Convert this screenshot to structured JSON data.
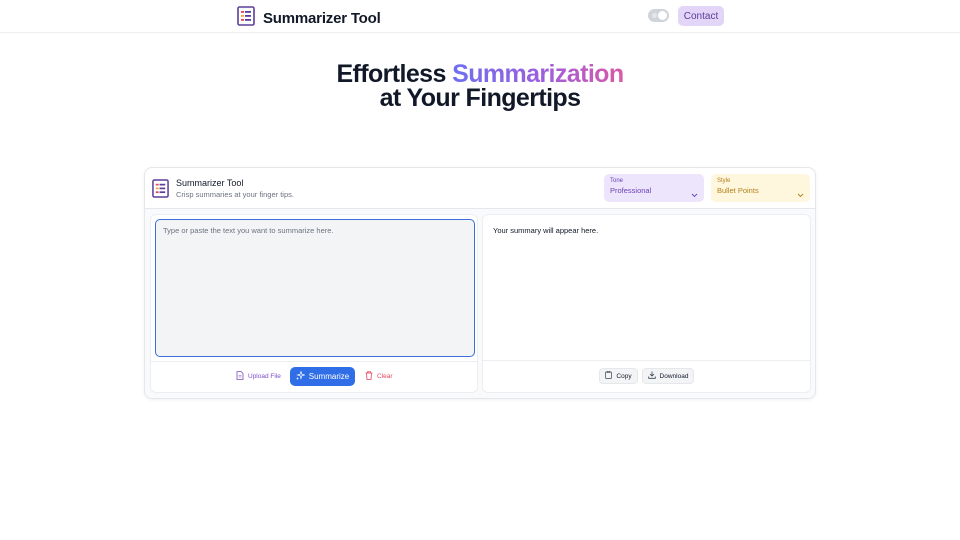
{
  "header": {
    "brand": "Summarizer Tool",
    "contact_label": "Contact"
  },
  "hero": {
    "line1_plain": "Effortless ",
    "line1_accent": "Summarization",
    "line2": "at Your Fingertips"
  },
  "card": {
    "title": "Summarizer Tool",
    "subtitle": "Crisp summaries at your finger tips.",
    "tone": {
      "label": "Tone",
      "value": "Professional"
    },
    "style": {
      "label": "Style",
      "value": "Bullet Points"
    }
  },
  "input": {
    "placeholder": "Type or paste the text you want to summarize here.",
    "value": ""
  },
  "actions": {
    "upload_label": "Upload File",
    "summarize_label": "Summarize",
    "clear_label": "Clear"
  },
  "output": {
    "placeholder_text": "Your summary will appear here.",
    "copy_label": "Copy",
    "download_label": "Download"
  },
  "icons": {
    "brand": "document-list-icon",
    "upload": "file-icon",
    "summarize": "sparkles-icon",
    "clear": "trash-icon",
    "copy": "clipboard-icon",
    "download": "download-icon",
    "chevron": "chevron-down-icon"
  },
  "colors": {
    "primary": "#2f6ee6",
    "accent_purple": "#6b3fb8",
    "accent_gold": "#b2811b",
    "danger": "#e0475f",
    "gradient_start": "#6e6ff0",
    "gradient_end": "#d85aa6"
  }
}
